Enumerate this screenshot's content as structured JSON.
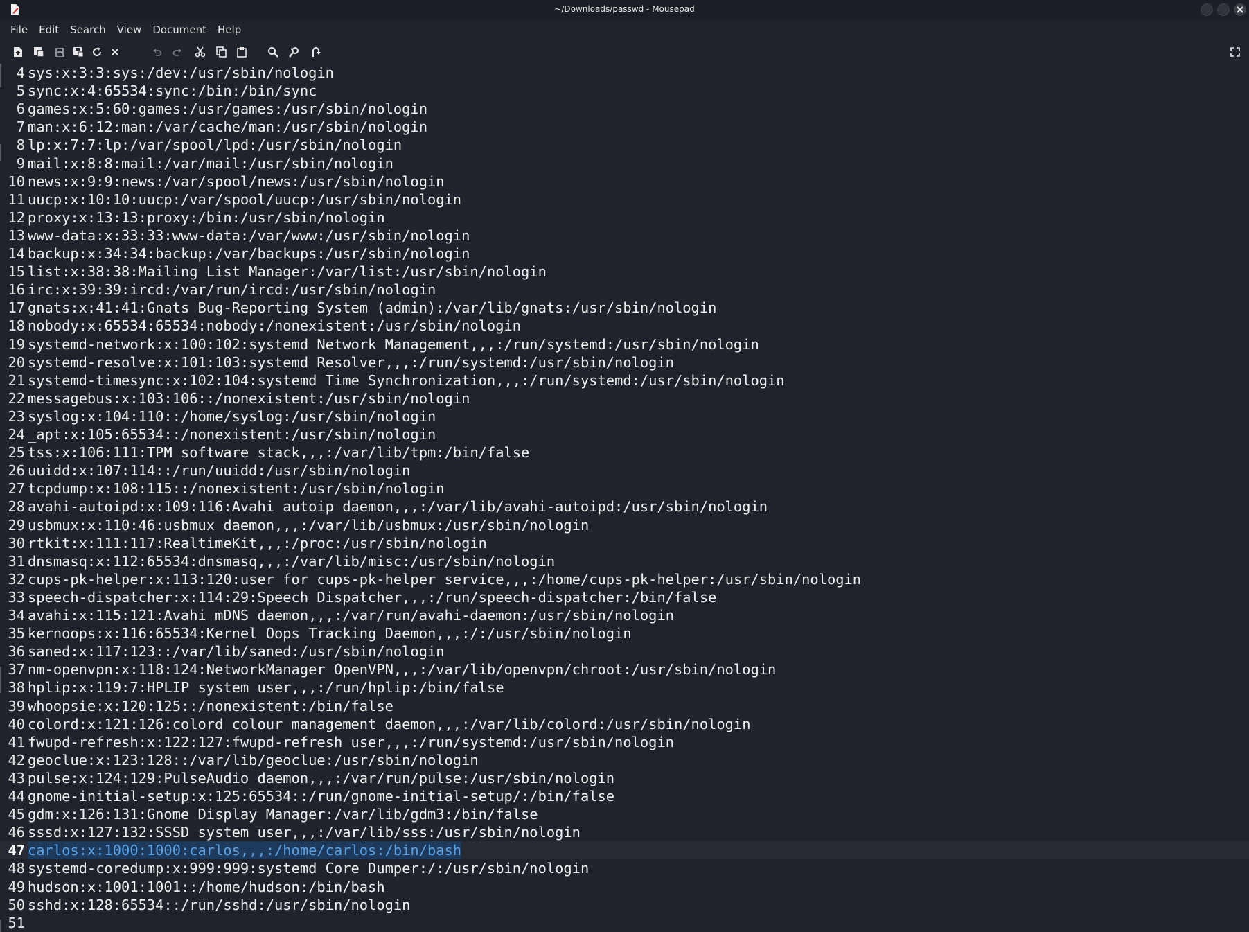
{
  "window": {
    "title": "~/Downloads/passwd - Mousepad"
  },
  "menu": [
    "File",
    "Edit",
    "Search",
    "View",
    "Document",
    "Help"
  ],
  "toolbar": {
    "icons": [
      "new-document-icon",
      "new-window-icon",
      "save-icon",
      "save-as-icon",
      "reload-icon",
      "close-document-icon",
      "undo-icon",
      "redo-icon",
      "cut-icon",
      "copy-icon",
      "paste-icon",
      "find-icon",
      "find-replace-icon",
      "goto-icon",
      "fullscreen-icon"
    ]
  },
  "editor": {
    "current_line": "47",
    "lines": [
      {
        "n": "4",
        "text": "sys:x:3:3:sys:/dev:/usr/sbin/nologin"
      },
      {
        "n": "5",
        "text": "sync:x:4:65534:sync:/bin:/bin/sync"
      },
      {
        "n": "6",
        "text": "games:x:5:60:games:/usr/games:/usr/sbin/nologin"
      },
      {
        "n": "7",
        "text": "man:x:6:12:man:/var/cache/man:/usr/sbin/nologin"
      },
      {
        "n": "8",
        "text": "lp:x:7:7:lp:/var/spool/lpd:/usr/sbin/nologin"
      },
      {
        "n": "9",
        "text": "mail:x:8:8:mail:/var/mail:/usr/sbin/nologin"
      },
      {
        "n": "10",
        "text": "news:x:9:9:news:/var/spool/news:/usr/sbin/nologin"
      },
      {
        "n": "11",
        "text": "uucp:x:10:10:uucp:/var/spool/uucp:/usr/sbin/nologin"
      },
      {
        "n": "12",
        "text": "proxy:x:13:13:proxy:/bin:/usr/sbin/nologin"
      },
      {
        "n": "13",
        "text": "www-data:x:33:33:www-data:/var/www:/usr/sbin/nologin"
      },
      {
        "n": "14",
        "text": "backup:x:34:34:backup:/var/backups:/usr/sbin/nologin"
      },
      {
        "n": "15",
        "text": "list:x:38:38:Mailing List Manager:/var/list:/usr/sbin/nologin"
      },
      {
        "n": "16",
        "text": "irc:x:39:39:ircd:/var/run/ircd:/usr/sbin/nologin"
      },
      {
        "n": "17",
        "text": "gnats:x:41:41:Gnats Bug-Reporting System (admin):/var/lib/gnats:/usr/sbin/nologin"
      },
      {
        "n": "18",
        "text": "nobody:x:65534:65534:nobody:/nonexistent:/usr/sbin/nologin"
      },
      {
        "n": "19",
        "text": "systemd-network:x:100:102:systemd Network Management,,,:/run/systemd:/usr/sbin/nologin"
      },
      {
        "n": "20",
        "text": "systemd-resolve:x:101:103:systemd Resolver,,,:/run/systemd:/usr/sbin/nologin"
      },
      {
        "n": "21",
        "text": "systemd-timesync:x:102:104:systemd Time Synchronization,,,:/run/systemd:/usr/sbin/nologin"
      },
      {
        "n": "22",
        "text": "messagebus:x:103:106::/nonexistent:/usr/sbin/nologin"
      },
      {
        "n": "23",
        "text": "syslog:x:104:110::/home/syslog:/usr/sbin/nologin"
      },
      {
        "n": "24",
        "text": "_apt:x:105:65534::/nonexistent:/usr/sbin/nologin"
      },
      {
        "n": "25",
        "text": "tss:x:106:111:TPM software stack,,,:/var/lib/tpm:/bin/false"
      },
      {
        "n": "26",
        "text": "uuidd:x:107:114::/run/uuidd:/usr/sbin/nologin"
      },
      {
        "n": "27",
        "text": "tcpdump:x:108:115::/nonexistent:/usr/sbin/nologin"
      },
      {
        "n": "28",
        "text": "avahi-autoipd:x:109:116:Avahi autoip daemon,,,:/var/lib/avahi-autoipd:/usr/sbin/nologin"
      },
      {
        "n": "29",
        "text": "usbmux:x:110:46:usbmux daemon,,,:/var/lib/usbmux:/usr/sbin/nologin"
      },
      {
        "n": "30",
        "text": "rtkit:x:111:117:RealtimeKit,,,:/proc:/usr/sbin/nologin"
      },
      {
        "n": "31",
        "text": "dnsmasq:x:112:65534:dnsmasq,,,:/var/lib/misc:/usr/sbin/nologin"
      },
      {
        "n": "32",
        "text": "cups-pk-helper:x:113:120:user for cups-pk-helper service,,,:/home/cups-pk-helper:/usr/sbin/nologin"
      },
      {
        "n": "33",
        "text": "speech-dispatcher:x:114:29:Speech Dispatcher,,,:/run/speech-dispatcher:/bin/false"
      },
      {
        "n": "34",
        "text": "avahi:x:115:121:Avahi mDNS daemon,,,:/var/run/avahi-daemon:/usr/sbin/nologin"
      },
      {
        "n": "35",
        "text": "kernoops:x:116:65534:Kernel Oops Tracking Daemon,,,:/:/usr/sbin/nologin"
      },
      {
        "n": "36",
        "text": "saned:x:117:123::/var/lib/saned:/usr/sbin/nologin"
      },
      {
        "n": "37",
        "text": "nm-openvpn:x:118:124:NetworkManager OpenVPN,,,:/var/lib/openvpn/chroot:/usr/sbin/nologin"
      },
      {
        "n": "38",
        "text": "hplip:x:119:7:HPLIP system user,,,:/run/hplip:/bin/false"
      },
      {
        "n": "39",
        "text": "whoopsie:x:120:125::/nonexistent:/bin/false"
      },
      {
        "n": "40",
        "text": "colord:x:121:126:colord colour management daemon,,,:/var/lib/colord:/usr/sbin/nologin"
      },
      {
        "n": "41",
        "text": "fwupd-refresh:x:122:127:fwupd-refresh user,,,:/run/systemd:/usr/sbin/nologin"
      },
      {
        "n": "42",
        "text": "geoclue:x:123:128::/var/lib/geoclue:/usr/sbin/nologin"
      },
      {
        "n": "43",
        "text": "pulse:x:124:129:PulseAudio daemon,,,:/var/run/pulse:/usr/sbin/nologin"
      },
      {
        "n": "44",
        "text": "gnome-initial-setup:x:125:65534::/run/gnome-initial-setup/:/bin/false"
      },
      {
        "n": "45",
        "text": "gdm:x:126:131:Gnome Display Manager:/var/lib/gdm3:/bin/false"
      },
      {
        "n": "46",
        "text": "sssd:x:127:132:SSSD system user,,,:/var/lib/sss:/usr/sbin/nologin"
      },
      {
        "n": "47",
        "text": "carlos:x:1000:1000:carlos,,,:/home/carlos:/bin/bash"
      },
      {
        "n": "48",
        "text": "systemd-coredump:x:999:999:systemd Core Dumper:/:/usr/sbin/nologin"
      },
      {
        "n": "49",
        "text": "hudson:x:1001:1001::/home/hudson:/bin/bash"
      },
      {
        "n": "50",
        "text": "sshd:x:128:65534::/run/sshd:/usr/sbin/nologin"
      },
      {
        "n": "51",
        "text": ""
      }
    ]
  },
  "colors": {
    "background": "#1f232b",
    "text": "#f0f0f0",
    "selection_bg": "#1d3a5c",
    "selection_text": "#5aa2e6",
    "current_line_bg": "#272b33"
  }
}
